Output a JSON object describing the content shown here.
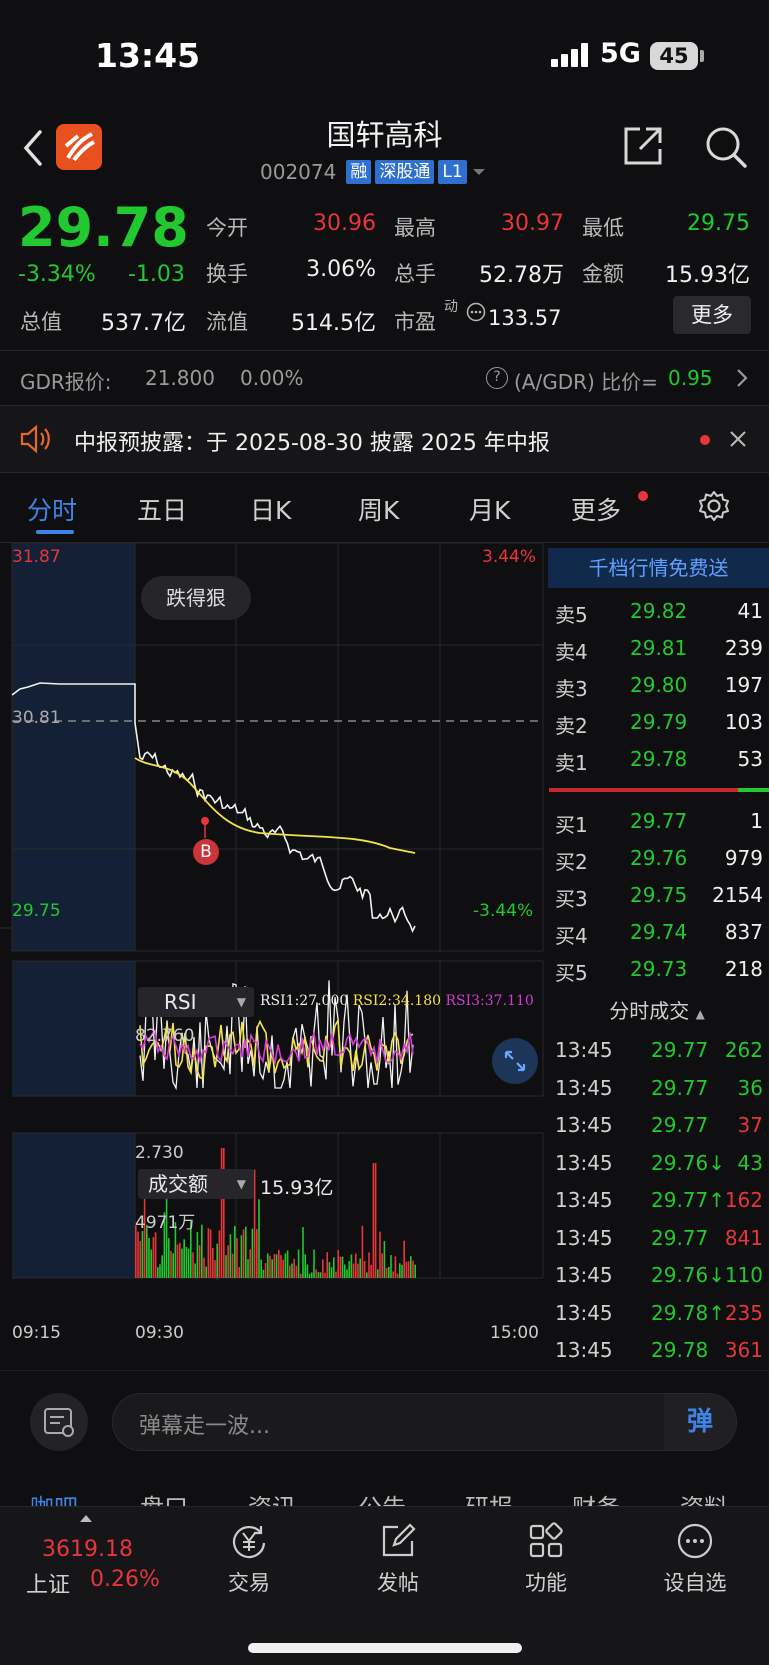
{
  "status_bar": {
    "time": "13:45",
    "network": "5G",
    "battery": "45"
  },
  "header": {
    "name": "国轩高科",
    "code": "002074",
    "tags": [
      "融",
      "深股通",
      "L1"
    ]
  },
  "quote": {
    "price": "29.78",
    "change_pct": "-3.34%",
    "change": "-1.03",
    "fields": [
      {
        "label": "今开",
        "value": "30.96",
        "color": "#e8353a"
      },
      {
        "label": "最高",
        "value": "30.97",
        "color": "#e8353a"
      },
      {
        "label": "最低",
        "value": "29.75",
        "color": "#22c82f"
      },
      {
        "label": "换手",
        "value": "3.06%",
        "color": "#f0f0f0"
      },
      {
        "label": "总手",
        "value": "52.78万",
        "color": "#f0f0f0"
      },
      {
        "label": "金额",
        "value": "15.93亿",
        "color": "#f0f0f0"
      },
      {
        "label": "总值",
        "value": "537.7亿",
        "color": "#f0f0f0"
      },
      {
        "label": "流值",
        "value": "514.5亿",
        "color": "#f0f0f0"
      },
      {
        "label": "市盈",
        "value": "133.57",
        "color": "#f0f0f0"
      }
    ],
    "pe_superscript": "动",
    "more_label": "更多"
  },
  "gdr": {
    "label": "GDR报价:",
    "price": "21.800",
    "pct": "0.00%",
    "ratio_label": "(A/GDR) 比价=",
    "ratio": "0.95"
  },
  "notice": {
    "text": "中报预披露：于 2025-08-30 披露 2025 年中报"
  },
  "tabs": [
    "分时",
    "五日",
    "日K",
    "周K",
    "月K",
    "更多"
  ],
  "chart": {
    "price_high": "31.87",
    "price_low": "29.75",
    "pct_high": "3.44%",
    "pct_low": "-3.44%",
    "prev_close": "30.81",
    "badge": "跌得狠",
    "marker": "B",
    "time_labels": [
      "09:15",
      "09:30",
      "15:00"
    ],
    "rsi_selector": "RSI",
    "rsi1": "RSI1:27.000",
    "rsi2": "RSI2:34.180",
    "rsi3": "RSI3:37.110",
    "rsi_high": "82.760",
    "rsi_low": "2.730",
    "volume_selector": "成交额",
    "volume_total": "15.93亿",
    "volume_max": "4971万"
  },
  "order_book": {
    "banner": "千档行情免费送",
    "asks": [
      {
        "label": "卖5",
        "price": "29.82",
        "qty": "41"
      },
      {
        "label": "卖4",
        "price": "29.81",
        "qty": "239"
      },
      {
        "label": "卖3",
        "price": "29.80",
        "qty": "197"
      },
      {
        "label": "卖2",
        "price": "29.79",
        "qty": "103"
      },
      {
        "label": "卖1",
        "price": "29.78",
        "qty": "53"
      }
    ],
    "bids": [
      {
        "label": "买1",
        "price": "29.77",
        "qty": "1"
      },
      {
        "label": "买2",
        "price": "29.76",
        "qty": "979"
      },
      {
        "label": "买3",
        "price": "29.75",
        "qty": "2154"
      },
      {
        "label": "买4",
        "price": "29.74",
        "qty": "837"
      },
      {
        "label": "买5",
        "price": "29.73",
        "qty": "218"
      }
    ],
    "trades_title": "分时成交",
    "trades": [
      {
        "time": "13:45",
        "price": "29.77",
        "qty": "262",
        "color": "#22c82f"
      },
      {
        "time": "13:45",
        "price": "29.77",
        "qty": "36",
        "color": "#22c82f"
      },
      {
        "time": "13:45",
        "price": "29.77",
        "qty": "37",
        "color": "#e8353a"
      },
      {
        "time": "13:45",
        "price": "29.76↓",
        "qty": "43",
        "color": "#22c82f"
      },
      {
        "time": "13:45",
        "price": "29.77↑",
        "qty": "162",
        "color": "#e8353a"
      },
      {
        "time": "13:45",
        "price": "29.77",
        "qty": "841",
        "color": "#e8353a"
      },
      {
        "time": "13:45",
        "price": "29.76↓",
        "qty": "110",
        "color": "#22c82f"
      },
      {
        "time": "13:45",
        "price": "29.78↑",
        "qty": "235",
        "color": "#e8353a"
      },
      {
        "time": "13:45",
        "price": "29.78",
        "qty": "361",
        "color": "#e8353a"
      }
    ]
  },
  "danmaku": {
    "placeholder": "弹幕走一波...",
    "send_label": "弹"
  },
  "subtabs": [
    "咖吧",
    "盘口",
    "资讯",
    "公告",
    "研报",
    "财务",
    "资料"
  ],
  "bottom_nav": {
    "index_value": "3619.18",
    "index_name": "上证",
    "index_pct": "0.26%",
    "items": [
      "交易",
      "发帖",
      "功能",
      "设自选"
    ]
  },
  "colors": {
    "up": "#e8353a",
    "down": "#22c82f",
    "accent": "#3e84e6",
    "avg_line": "#f2e24a"
  }
}
